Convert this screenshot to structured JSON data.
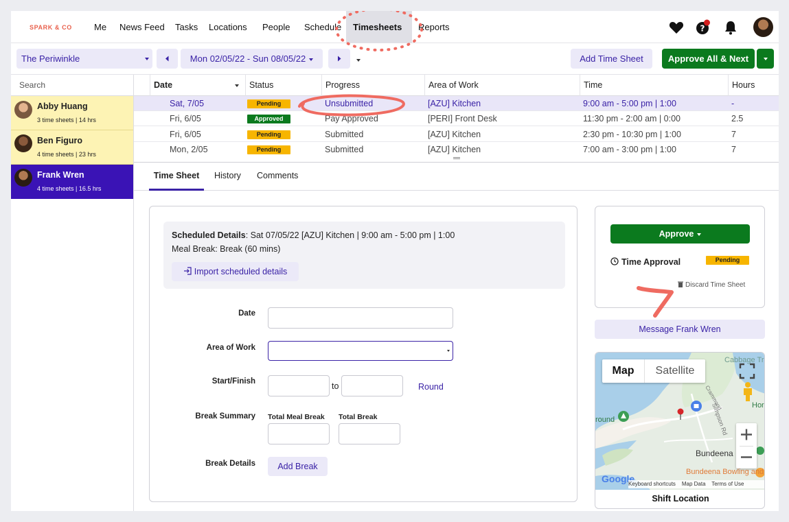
{
  "brand": "SPARK & CO",
  "nav": {
    "items": [
      "Me",
      "News Feed",
      "Tasks",
      "Locations",
      "People",
      "Schedule"
    ],
    "active": "Timesheets",
    "reports": "Reports"
  },
  "toolbar": {
    "location": "The Periwinkle",
    "date_range": "Mon 02/05/22 - Sun 08/05/22",
    "add_time_sheet": "Add Time Sheet",
    "approve_all": "Approve All & Next"
  },
  "left_panel": {
    "search_placeholder": "Search",
    "people": [
      {
        "name": "Abby Huang",
        "meta": "3 time sheets | 14 hrs"
      },
      {
        "name": "Ben Figuro",
        "meta": "4 time sheets | 23 hrs"
      },
      {
        "name": "Frank Wren",
        "meta": "4 time sheets | 16.5 hrs"
      }
    ]
  },
  "table": {
    "headers": {
      "date": "Date",
      "status": "Status",
      "progress": "Progress",
      "area": "Area of Work",
      "time": "Time",
      "hours": "Hours"
    },
    "rows": [
      {
        "date": "Sat, 7/05",
        "status": "Pending",
        "progress": "Unsubmitted",
        "area": "[AZU] Kitchen",
        "time": "9:00 am - 5:00 pm | 1:00",
        "hours": "-"
      },
      {
        "date": "Fri, 6/05",
        "status": "Approved",
        "progress": "Pay Approved",
        "area": "[PERI] Front Desk",
        "time": "11:30 pm - 2:00 am | 0:00",
        "hours": "2.5"
      },
      {
        "date": "Fri, 6/05",
        "status": "Pending",
        "progress": "Submitted",
        "area": "[AZU] Kitchen",
        "time": "2:30 pm - 10:30 pm | 1:00",
        "hours": "7"
      },
      {
        "date": "Mon, 2/05",
        "status": "Pending",
        "progress": "Submitted",
        "area": "[AZU] Kitchen",
        "time": "7:00 am - 3:00 pm | 1:00",
        "hours": "7"
      }
    ]
  },
  "tabs": [
    "Time Sheet",
    "History",
    "Comments"
  ],
  "form": {
    "scheduled_label": "Scheduled Details",
    "scheduled_value": ": Sat 07/05/22 [AZU] Kitchen | 9:00 am - 5:00 pm | 1:00",
    "meal_break": "Meal Break: Break (60 mins)",
    "import_button": "Import scheduled details",
    "date_label": "Date",
    "area_label": "Area of Work",
    "start_finish_label": "Start/Finish",
    "to": "to",
    "round": "Round",
    "break_summary_label": "Break Summary",
    "total_meal_break": "Total Meal Break",
    "total_break": "Total Break",
    "break_details_label": "Break Details",
    "add_break": "Add Break"
  },
  "approval": {
    "approve": "Approve",
    "time_approval": "Time Approval",
    "status": "Pending",
    "discard": "Discard Time Sheet"
  },
  "message_button": "Message Frank Wren",
  "map": {
    "tab_map": "Map",
    "tab_satellite": "Satellite",
    "place_1": "Bundeena",
    "place_2": "Bundeena Bowling and Sports Club",
    "place_3": "Cabbage Tree Point",
    "place_4": "Simpson Rd",
    "place_5": "Crammond",
    "place_6": "round",
    "place_7": "Hor",
    "google": "Google",
    "keyboard": "Keyboard shortcuts",
    "map_data": "Map Data",
    "terms": "Terms of Use",
    "caption": "Shift Location"
  },
  "colors": {
    "accent": "#3a22a6",
    "green": "#0b7a1e",
    "pending": "#f7b500",
    "highlight_yellow": "#fdf3b4",
    "annotation": "#ef6b61"
  }
}
